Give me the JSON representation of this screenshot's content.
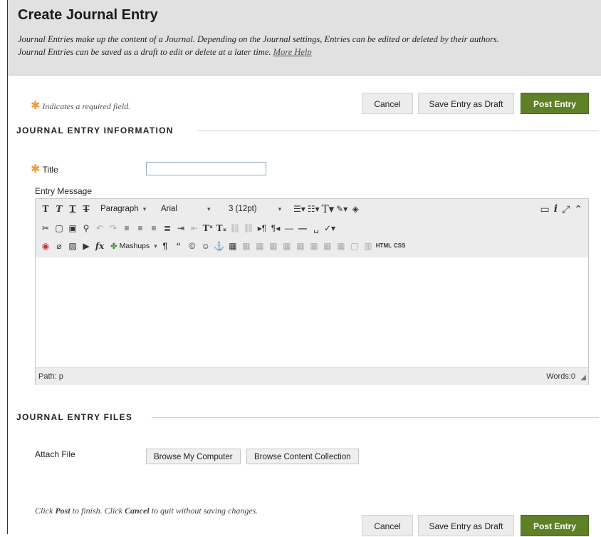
{
  "header": {
    "title": "Create Journal Entry",
    "intro_line1": "Journal Entries make up the content of a Journal. Depending on the Journal settings, Entries can be edited or deleted by their authors.",
    "intro_line2": "Journal Entries can be saved as a draft to edit or delete at a later time.",
    "more_help": "More Help"
  },
  "actions": {
    "cancel": "Cancel",
    "save_draft": "Save Entry as Draft",
    "post": "Post Entry"
  },
  "required_note": "Indicates a required field.",
  "required_star": "✱",
  "info_section": {
    "heading": "JOURNAL ENTRY INFORMATION",
    "title_label": "Title",
    "title_value": "",
    "message_label": "Entry Message"
  },
  "editor": {
    "format_select": "Paragraph",
    "font_select": "Arial",
    "size_select": "3 (12pt)",
    "mashups": "Mashups",
    "html_btn": "HTML",
    "css_btn": "CSS",
    "path_label": "Path: p",
    "words_label": "Words:0"
  },
  "files_section": {
    "heading": "JOURNAL ENTRY FILES",
    "attach_label": "Attach File",
    "browse_computer": "Browse My Computer",
    "browse_collection": "Browse Content Collection"
  },
  "footer": {
    "pre": "Click ",
    "post_word": "Post",
    "mid": " to finish. Click ",
    "cancel_word": "Cancel",
    "end": " to quit without saving changes."
  }
}
